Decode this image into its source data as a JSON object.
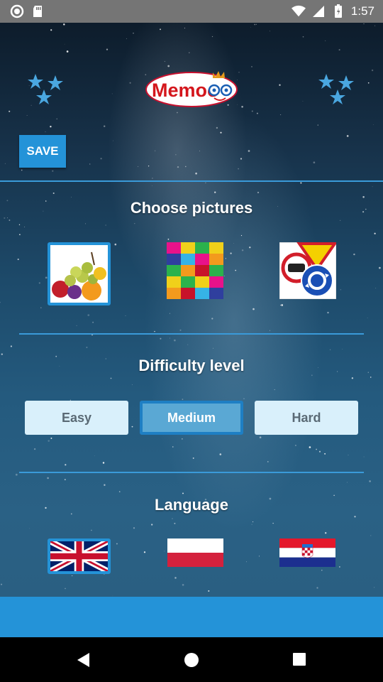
{
  "status_bar": {
    "time": "1:57",
    "icons": [
      "record-icon",
      "sd-card-icon",
      "wifi-icon",
      "signal-icon",
      "battery-icon"
    ]
  },
  "app": {
    "logo_text": "Memoo",
    "save_label": "SAVE",
    "sections": {
      "pictures_title": "Choose pictures",
      "difficulty_title": "Difficulty level",
      "language_title": "Language"
    },
    "picture_sets": [
      {
        "name": "fruits",
        "selected": true
      },
      {
        "name": "colors",
        "selected": false
      },
      {
        "name": "traffic-signs",
        "selected": false
      }
    ],
    "difficulty": [
      {
        "label": "Easy",
        "selected": false
      },
      {
        "label": "Medium",
        "selected": true
      },
      {
        "label": "Hard",
        "selected": false
      }
    ],
    "languages": [
      {
        "name": "english-flag",
        "selected": true
      },
      {
        "name": "polish-flag",
        "selected": false
      },
      {
        "name": "croatian-flag",
        "selected": false
      }
    ],
    "colors": {
      "accent": "#2493d8",
      "button_bg": "#d9f0fb",
      "selected_button_bg": "#5aa8d4"
    }
  },
  "nav_bar": {
    "icons": [
      "back-icon",
      "home-icon",
      "recents-icon"
    ]
  }
}
